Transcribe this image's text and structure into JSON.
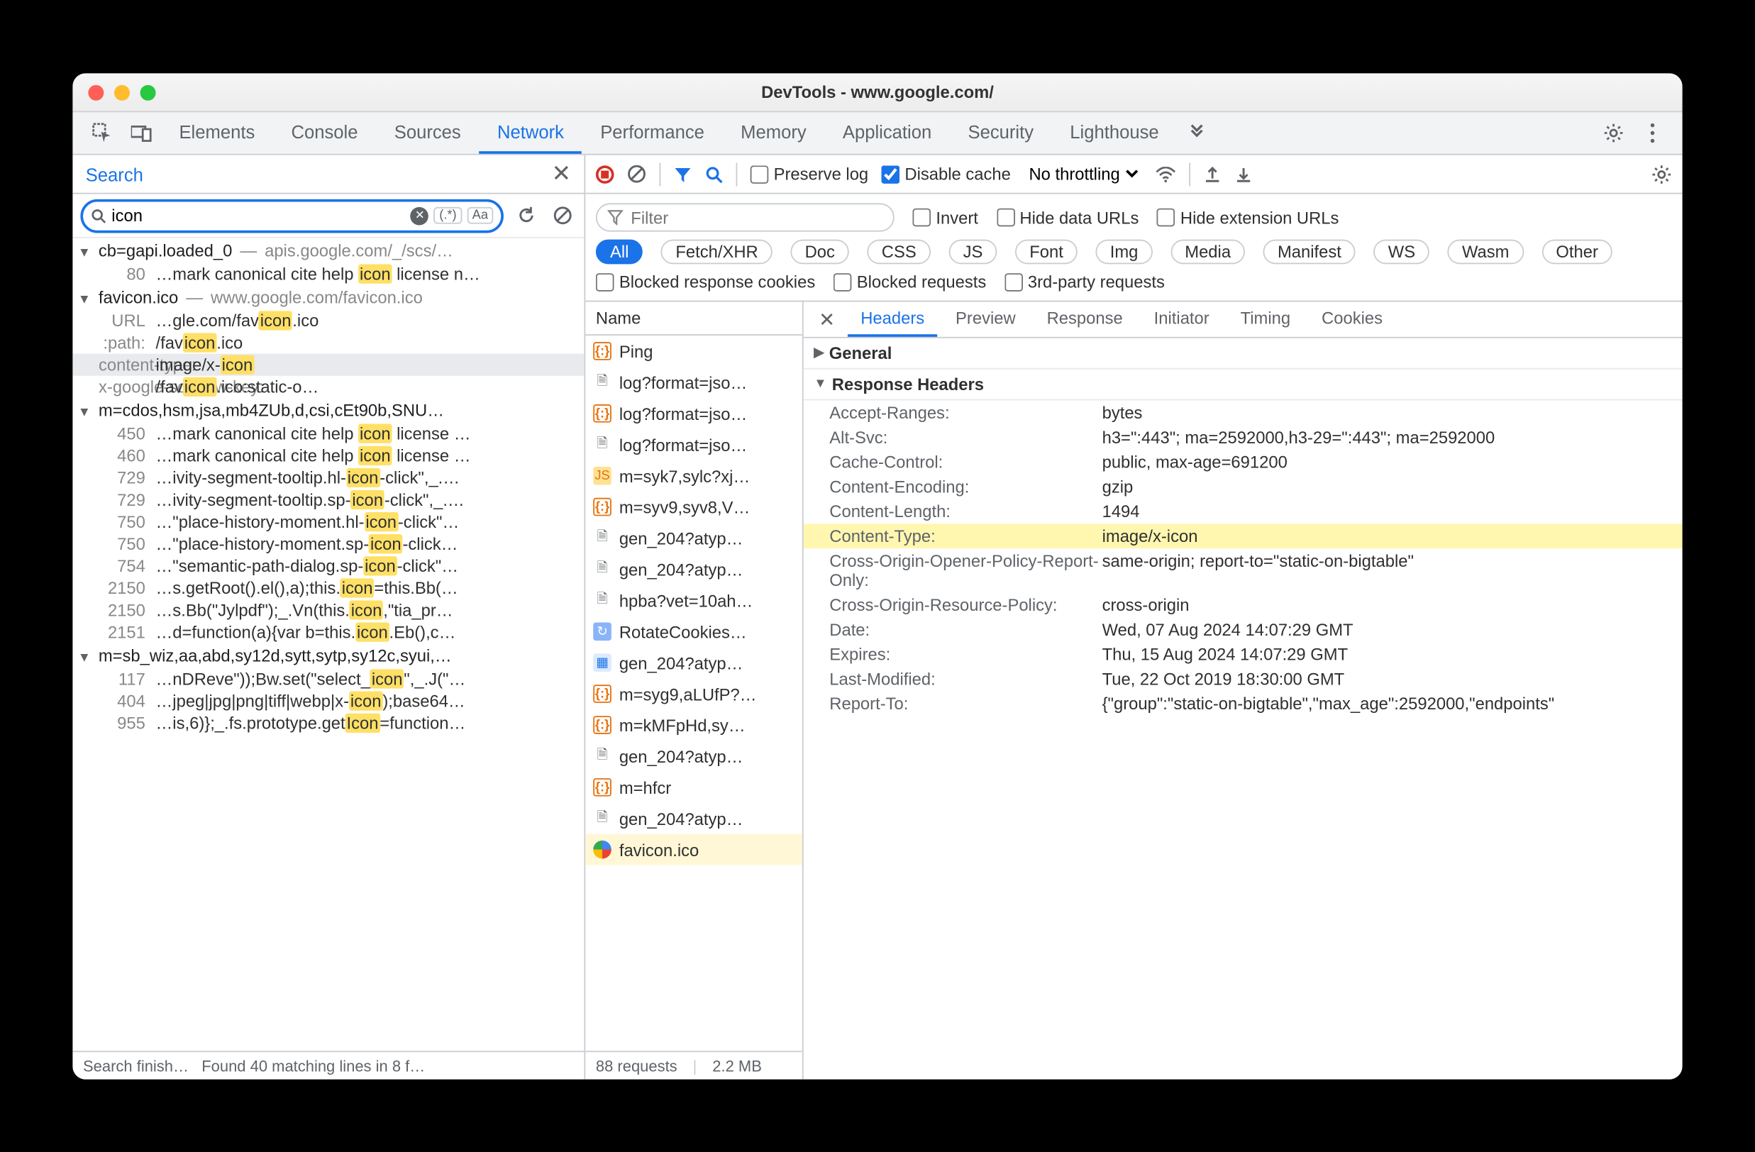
{
  "window_title": "DevTools - www.google.com/",
  "tabs": [
    "Elements",
    "Console",
    "Sources",
    "Network",
    "Performance",
    "Memory",
    "Application",
    "Security",
    "Lighthouse"
  ],
  "active_tab": "Network",
  "search": {
    "panel_label": "Search",
    "query": "icon",
    "regex_label": "(.*)",
    "case_label": "Aa",
    "status_1": "Search finish…",
    "status_2": "Found 40 matching lines in 8 f…"
  },
  "search_results": [
    {
      "file": "cb=gapi.loaded_0",
      "path": "apis.google.com/_/scs/…",
      "matches": [
        {
          "line": "80",
          "before": "…mark canonical cite help ",
          "hit": "icon",
          "after": " license n…"
        }
      ]
    },
    {
      "file": "favicon.ico",
      "path": "www.google.com/favicon.ico",
      "matches": [
        {
          "line": "URL",
          "before": "…gle.com/fav",
          "hit": "icon",
          "after": ".ico"
        },
        {
          "line": ":path:",
          "before": "/fav",
          "hit": "icon",
          "after": ".ico"
        },
        {
          "line": "content-type:",
          "before": "image/x-",
          "hit": "icon",
          "after": "",
          "hl": true
        },
        {
          "line": "x-google-scs-row-key:",
          "before": "/fav",
          "hit": "icon",
          "after": ".ico:static-o…"
        }
      ]
    },
    {
      "file": "m=cdos,hsm,jsa,mb4ZUb,d,csi,cEt90b,SNU…",
      "path": "",
      "matches": [
        {
          "line": "450",
          "before": "…mark canonical cite help ",
          "hit": "icon",
          "after": " license …"
        },
        {
          "line": "460",
          "before": "…mark canonical cite help ",
          "hit": "icon",
          "after": " license …"
        },
        {
          "line": "729",
          "before": "…ivity-segment-tooltip.hl-",
          "hit": "icon",
          "after": "-click\",_.…"
        },
        {
          "line": "729",
          "before": "…ivity-segment-tooltip.sp-",
          "hit": "icon",
          "after": "-click\",_.…"
        },
        {
          "line": "750",
          "before": "…\"place-history-moment.hl-",
          "hit": "icon",
          "after": "-click\"…"
        },
        {
          "line": "750",
          "before": "…\"place-history-moment.sp-",
          "hit": "icon",
          "after": "-click…"
        },
        {
          "line": "754",
          "before": "…\"semantic-path-dialog.sp-",
          "hit": "icon",
          "after": "-click\"…"
        },
        {
          "line": "2150",
          "before": "…s.getRoot().el(),a);this.",
          "hit": "icon",
          "after": "=this.Bb(…"
        },
        {
          "line": "2150",
          "before": "…s.Bb(\"Jylpdf\");_.Vn(this.",
          "hit": "icon",
          "after": ",\"tia_pr…"
        },
        {
          "line": "2151",
          "before": "…d=function(a){var b=this.",
          "hit": "icon",
          "after": ".Eb(),c…"
        }
      ]
    },
    {
      "file": "m=sb_wiz,aa,abd,sy12d,sytt,sytp,sy12c,syui,…",
      "path": "",
      "matches": [
        {
          "line": "117",
          "before": "…nDReve\"));Bw.set(\"select_",
          "hit": "icon",
          "after": "\",_.J(\"…"
        },
        {
          "line": "404",
          "before": "…jpeg|jpg|png|tiff|webp|x-",
          "hit": "icon",
          "after": ");base64…"
        },
        {
          "line": "955",
          "before": "…is,6)};_.fs.prototype.get",
          "hit": "Icon",
          "after": "=function…"
        }
      ]
    }
  ],
  "net_toolbar": {
    "preserve_log": "Preserve log",
    "disable_cache": "Disable cache",
    "throttling": "No throttling"
  },
  "net_filter": {
    "placeholder": "Filter",
    "invert": "Invert",
    "hide_data": "Hide data URLs",
    "hide_ext": "Hide extension URLs",
    "blocked_cookies": "Blocked response cookies",
    "blocked_req": "Blocked requests",
    "third_party": "3rd-party requests",
    "chips": [
      "All",
      "Fetch/XHR",
      "Doc",
      "CSS",
      "JS",
      "Font",
      "Img",
      "Media",
      "Manifest",
      "WS",
      "Wasm",
      "Other"
    ]
  },
  "requests": {
    "header": "Name",
    "footer_count": "88 requests",
    "footer_size": "2.2 MB",
    "items": [
      {
        "name": "Ping",
        "icon": "json"
      },
      {
        "name": "log?format=jso…",
        "icon": "doc"
      },
      {
        "name": "log?format=jso…",
        "icon": "json"
      },
      {
        "name": "log?format=jso…",
        "icon": "doc"
      },
      {
        "name": "m=syk7,sylc?xj…",
        "icon": "js"
      },
      {
        "name": "m=syv9,syv8,V…",
        "icon": "json"
      },
      {
        "name": "gen_204?atyp…",
        "icon": "doc"
      },
      {
        "name": "gen_204?atyp…",
        "icon": "doc"
      },
      {
        "name": "hpba?vet=10ah…",
        "icon": "doc"
      },
      {
        "name": "RotateCookies…",
        "icon": "cookie"
      },
      {
        "name": "gen_204?atyp…",
        "icon": "img"
      },
      {
        "name": "m=syg9,aLUfP?…",
        "icon": "json"
      },
      {
        "name": "m=kMFpHd,sy…",
        "icon": "json"
      },
      {
        "name": "gen_204?atyp…",
        "icon": "doc"
      },
      {
        "name": "m=hfcr",
        "icon": "json"
      },
      {
        "name": "gen_204?atyp…",
        "icon": "doc"
      },
      {
        "name": "favicon.ico",
        "icon": "goog",
        "selected": true
      }
    ]
  },
  "detail_tabs": [
    "Headers",
    "Preview",
    "Response",
    "Initiator",
    "Timing",
    "Cookies"
  ],
  "detail": {
    "general": "General",
    "response_headers": "Response Headers",
    "headers": [
      {
        "k": "Accept-Ranges:",
        "v": "bytes"
      },
      {
        "k": "Alt-Svc:",
        "v": "h3=\":443\"; ma=2592000,h3-29=\":443\"; ma=2592000"
      },
      {
        "k": "Cache-Control:",
        "v": "public, max-age=691200"
      },
      {
        "k": "Content-Encoding:",
        "v": "gzip"
      },
      {
        "k": "Content-Length:",
        "v": "1494"
      },
      {
        "k": "Content-Type:",
        "v": "image/x-icon",
        "hl": true
      },
      {
        "k": "Cross-Origin-Opener-Policy-Report-Only:",
        "v": "same-origin; report-to=\"static-on-bigtable\""
      },
      {
        "k": "Cross-Origin-Resource-Policy:",
        "v": "cross-origin"
      },
      {
        "k": "Date:",
        "v": "Wed, 07 Aug 2024 14:07:29 GMT"
      },
      {
        "k": "Expires:",
        "v": "Thu, 15 Aug 2024 14:07:29 GMT"
      },
      {
        "k": "Last-Modified:",
        "v": "Tue, 22 Oct 2019 18:30:00 GMT"
      },
      {
        "k": "Report-To:",
        "v": "{\"group\":\"static-on-bigtable\",\"max_age\":2592000,\"endpoints\""
      }
    ]
  }
}
